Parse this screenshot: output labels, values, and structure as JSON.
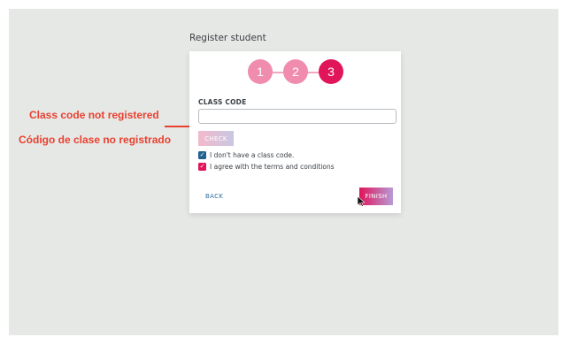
{
  "annotations": {
    "english": "Class code not registered",
    "spanish": "Código de clase no registrado"
  },
  "page": {
    "title": "Register student"
  },
  "stepper": {
    "steps": [
      "1",
      "2",
      "3"
    ],
    "active_step": 3
  },
  "form": {
    "class_code_label": "CLASS CODE",
    "class_code_value": "",
    "check_label": "CHECK",
    "no_class_code": {
      "label": "I don't have a class code.",
      "checked": true
    },
    "agree_terms": {
      "label": "I agree with the terms and conditions",
      "checked": true
    }
  },
  "actions": {
    "back_label": "BACK",
    "finish_label": "FINISH"
  },
  "colors": {
    "accent_pink": "#e0155a",
    "step_inactive": "#f08cae",
    "checkbox_blue": "#20618f",
    "annotation_red": "#e8412f",
    "background": "#e6e8e6"
  }
}
